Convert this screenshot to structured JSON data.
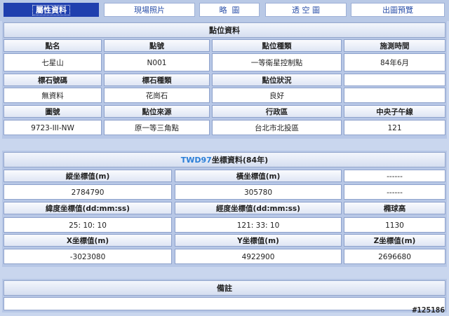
{
  "tabs": [
    {
      "label": "屬性資料",
      "active": true
    },
    {
      "label": "現場照片",
      "active": false
    },
    {
      "label": "略  圖",
      "active": false
    },
    {
      "label": "透 空 圖",
      "active": false
    },
    {
      "label": "出圖預覽",
      "active": false
    }
  ],
  "point_info": {
    "title": "點位資料",
    "row1_labels": [
      "點名",
      "點號",
      "點位種類",
      "施測時間"
    ],
    "row1_values": [
      "七星山",
      "N001",
      "一等衛星控制點",
      "84年6月"
    ],
    "row2_labels": [
      "標石號碼",
      "標石種類",
      "點位狀況",
      ""
    ],
    "row2_values": [
      "無資料",
      "花崗石",
      "良好",
      ""
    ],
    "row3_labels": [
      "圖號",
      "點位來源",
      "行政區",
      "中央子午線"
    ],
    "row3_values": [
      "9723-III-NW",
      "原一等三角點",
      "台北市北投區",
      "121"
    ]
  },
  "coord_info": {
    "title_highlight": "TWD97",
    "title_rest": "坐標資料(84年)",
    "row1_labels": [
      "縱坐標值(m)",
      "橫坐標值(m)",
      "------"
    ],
    "row1_values": [
      "2784790",
      "305780",
      "------"
    ],
    "row2_labels": [
      "緯度坐標值(dd:mm:ss)",
      "經度坐標值(dd:mm:ss)",
      "橢球高"
    ],
    "row2_values": [
      "25: 10: 10",
      "121: 33: 10",
      "1130"
    ],
    "row3_labels": [
      "X坐標值(m)",
      "Y坐標值(m)",
      "Z坐標值(m)"
    ],
    "row3_values": [
      "-3023080",
      "4922900",
      "2696680"
    ]
  },
  "remarks": {
    "title": "備註",
    "value": ""
  },
  "watermark": "#125186",
  "colors": {
    "active_tab": "#1f3fae",
    "tab_text": "#2a4fa8",
    "title_highlight": "#2b7fd8"
  }
}
